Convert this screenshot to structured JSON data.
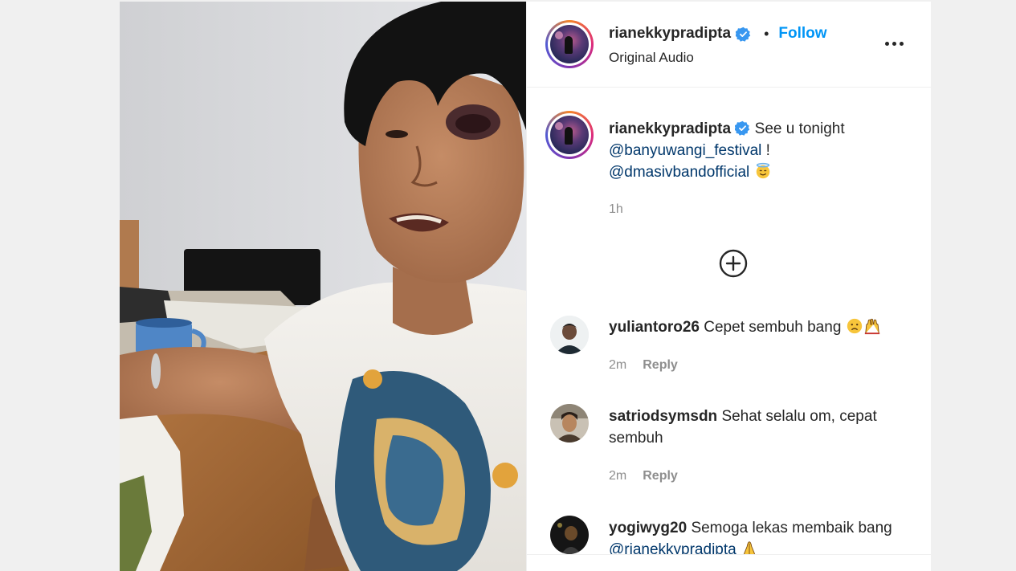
{
  "header": {
    "username": "rianekkypradipta",
    "separator": "•",
    "follow_label": "Follow",
    "subtitle": "Original Audio",
    "more_icon": "more-horizontal-icon"
  },
  "caption": {
    "username": "rianekkypradipta",
    "text_before": "See u tonight",
    "mention_1": "@banyuwangi_festival",
    "text_mid": " !",
    "mention_2": "@dmasivbandofficial",
    "emoji": "smiling-face-with-halo",
    "time": "1h"
  },
  "load_more_icon": "plus-circle-icon",
  "comments": [
    {
      "username": "yuliantoro26",
      "text": "Cepet sembuh bang",
      "emojis": [
        "sad-face",
        "raised-hands"
      ],
      "time": "2m",
      "reply_label": "Reply"
    },
    {
      "username": "satriodsymsdn",
      "text": "Sehat selalu om, cepat sembuh",
      "time": "2m",
      "reply_label": "Reply"
    },
    {
      "username": "yogiwyg20",
      "text": "Semoga lekas membaik bang",
      "mention": "@rianekkypradipta",
      "emoji": "folded-hands"
    }
  ],
  "colors": {
    "link": "#0095f6",
    "mention": "#00376b",
    "secondary_text": "#8e8e8e",
    "verified": "#3897f0"
  }
}
